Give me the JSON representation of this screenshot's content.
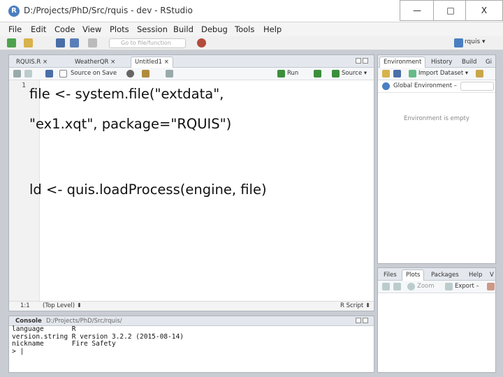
{
  "window": {
    "title": "D:/Projects/PhD/Src/rquis - dev - RStudio",
    "app_icon_letter": "R",
    "minimize": "—",
    "maximize": "□",
    "close": "X"
  },
  "menu": [
    "File",
    "Edit",
    "Code",
    "View",
    "Plots",
    "Session",
    "Build",
    "Debug",
    "Tools",
    "Help"
  ],
  "toolbar": {
    "goto_placeholder": "Go to file/function",
    "project_label": "rquis ▾"
  },
  "source_pane": {
    "tabs": [
      "RQUIS.R ×",
      "WeatherQR ×",
      "Untitled1 ×"
    ],
    "source_on_save": "Source on Save",
    "run": "Run",
    "source": "Source ▾",
    "line_number": "1",
    "code_lines": [
      "file <- system.file(\"extdata\",",
      "\"ex1.xqt\", package=\"RQUIS\")",
      "",
      "ld <- quis.loadProcess(engine, file)"
    ],
    "status_pos": "1:1",
    "status_level": "(Top Level) ⬍",
    "status_type": "R Script ⬍"
  },
  "console": {
    "title": "Console",
    "path": "D:/Projects/PhD/Src/rquis/",
    "lines": [
      "language       R",
      "version.string R version 3.2.2 (2015-08-14)",
      "nickname       Fire Safety",
      "> |"
    ]
  },
  "env_pane": {
    "tabs": [
      "Environment",
      "History",
      "Build",
      "Gi"
    ],
    "import_dataset": "Import Dataset ▾",
    "global_env": "Global Environment –",
    "empty_text": "Environment is empty"
  },
  "files_pane": {
    "tabs": [
      "Files",
      "Plots",
      "Packages",
      "Help",
      "V"
    ],
    "zoom": "Zoom",
    "export": "Export –"
  },
  "colors": {
    "frame": "#c9cdd3",
    "tabstrip": "#e4e8ee",
    "accent_blue": "#4a7fc1",
    "run_green": "#3b8f3b"
  }
}
